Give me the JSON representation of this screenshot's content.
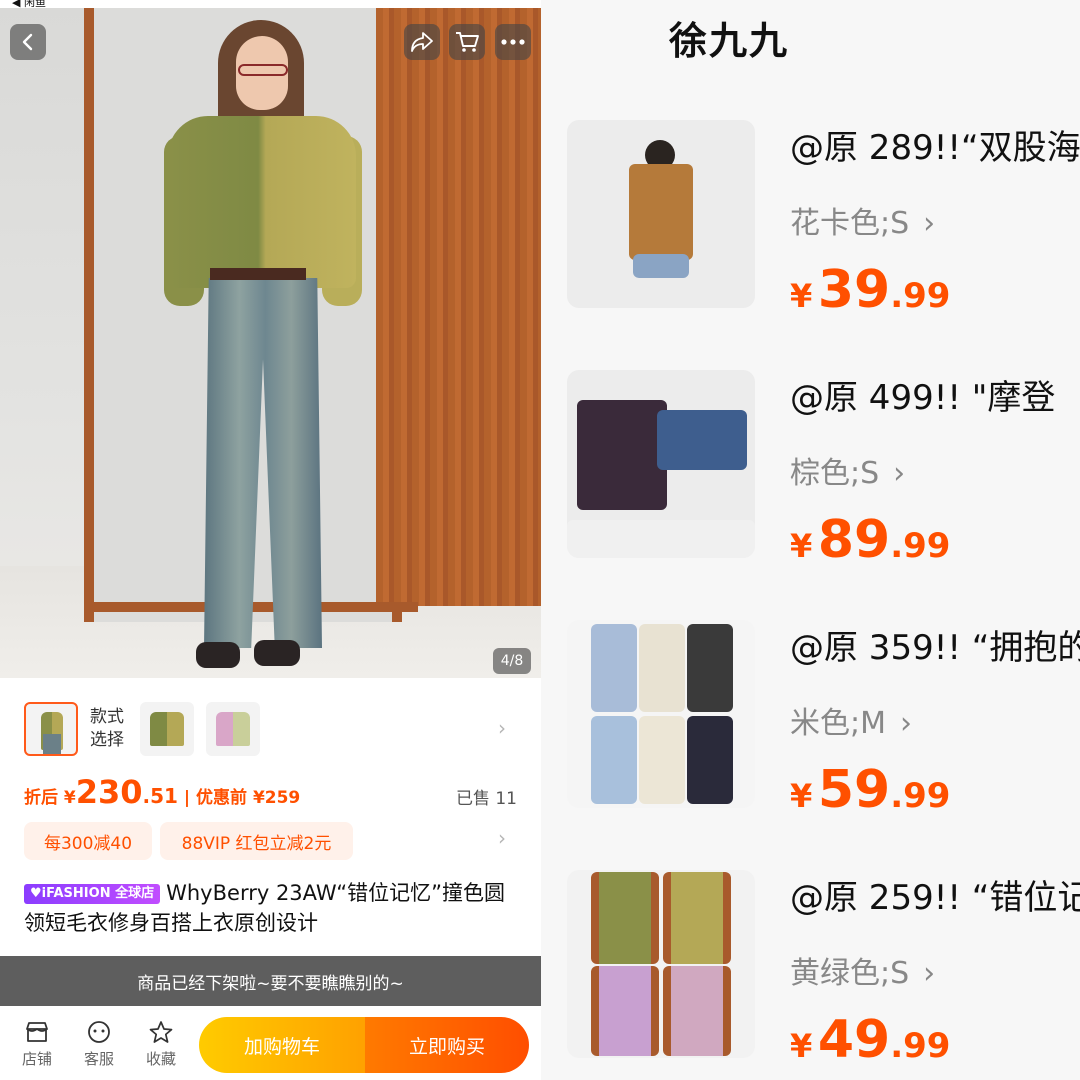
{
  "status_bar": {
    "back_app": "◀ 闲鱼"
  },
  "product": {
    "image_counter": "4/8",
    "style_label": "款式\n选择",
    "price_prefix": "折后 ¥",
    "price_int": "230",
    "price_dec": ".51",
    "price_sep": " | 优惠前 ¥259",
    "sold": "已售 11",
    "promos": [
      "每300减40",
      "88VIP 红包立减2元"
    ],
    "brand_badge": "♥iFASHION 全球店",
    "title": "WhyBerry 23AW“错位记忆”撞色圆领短毛衣修身百搭上衣原创设计",
    "offline_notice": "商品已经下架啦~要不要瞧瞧别的~"
  },
  "bottom_bar": {
    "shop": "店铺",
    "service": "客服",
    "favorite": "收藏",
    "add_cart": "加购物车",
    "buy_now": "立即购买"
  },
  "colors": {
    "accent": "#ff5000",
    "cart_btn": "#ffb300",
    "buy_btn": "#ff5a00",
    "badge": "#9b45ff"
  },
  "shop": {
    "name": "徐九九",
    "items": [
      {
        "title": "@原 289!!“双股海",
        "spec": "花卡色;S",
        "currency": "¥",
        "price_int": "39",
        "price_dec": ".99"
      },
      {
        "title": "@原 499!!  \"摩登",
        "spec": "棕色;S",
        "currency": "¥",
        "price_int": "89",
        "price_dec": ".99"
      },
      {
        "title": "@原 359!! “拥抱的",
        "spec": "米色;M",
        "currency": "¥",
        "price_int": "59",
        "price_dec": ".99"
      },
      {
        "title": "@原 259!! “错位记",
        "spec": "黄绿色;S",
        "currency": "¥",
        "price_int": "49",
        "price_dec": ".99"
      }
    ]
  }
}
